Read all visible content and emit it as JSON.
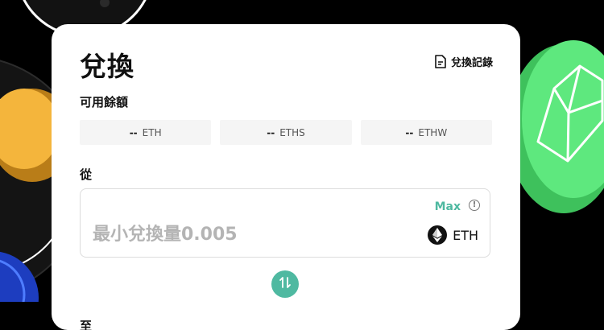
{
  "header": {
    "title": "兌換",
    "history_label": "兌換記錄"
  },
  "balance": {
    "label": "可用餘額",
    "items": [
      {
        "value": "--",
        "token": "ETH"
      },
      {
        "value": "--",
        "token": "ETHS"
      },
      {
        "value": "--",
        "token": "ETHW"
      }
    ]
  },
  "from": {
    "label": "從",
    "max_label": "Max",
    "info_symbol": "!",
    "amount_placeholder": "最小兌換量0.005",
    "token": "ETH"
  },
  "to": {
    "label": "至"
  },
  "colors": {
    "accent": "#4fb9a1",
    "background": "#000000",
    "card": "#ffffff",
    "coin_green": "#47d368"
  },
  "icons": {
    "history": "document-icon",
    "swap": "swap-arrows-icon",
    "eth": "ethereum-icon",
    "info": "info-icon"
  }
}
